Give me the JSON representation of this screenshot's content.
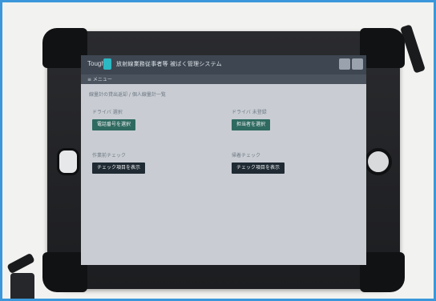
{
  "colors": {
    "border": "#3b97d9",
    "case": "#1c1d20",
    "screen_bg": "#c9cdd3",
    "header": "#3d4651",
    "accent_logo": "#2cb8c2",
    "button_green": "#2f6a60",
    "button_dark": "#1f2a33"
  },
  "app": {
    "logo_text": "Tough",
    "title": "放射線業務従事者等 被ばく管理システム",
    "subbar": "≡  メニュー"
  },
  "breadcrumb": "線量計の貸出返却 / 個人線量計一覧",
  "sections": [
    {
      "label": "ドライバ 選択",
      "button": "電話番号を選択"
    },
    {
      "label": "ドライバ 未登録",
      "button": "担当者を選択"
    },
    {
      "label": "作業前チェック",
      "button": "チェック項目を表示"
    },
    {
      "label": "帰着チェック",
      "button": "チェック項目を表示"
    }
  ]
}
